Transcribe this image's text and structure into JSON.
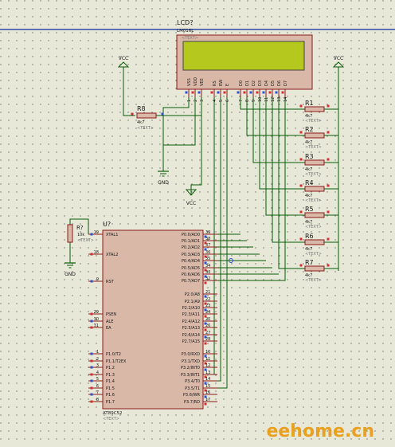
{
  "lcd": {
    "ref": "LCD?",
    "part": "LM016L",
    "text_tag": "<TEXT>",
    "pins": [
      "VSS",
      "VDD",
      "VEE",
      "RS",
      "RW",
      "E",
      "D0",
      "D1",
      "D2",
      "D3",
      "D4",
      "D5",
      "D6",
      "D7"
    ],
    "pin_numbers": [
      "1",
      "2",
      "3",
      "4",
      "5",
      "6",
      "7",
      "8",
      "9",
      "10",
      "11",
      "12",
      "13",
      "14"
    ],
    "screen_color": "#b5c81e"
  },
  "power": {
    "vcc_label_left": "VCC",
    "vcc_label_right": "VCC",
    "vcc_label_mid": "VCC",
    "gnd_label_lcd": "GND",
    "gnd_label_mcu": "GND"
  },
  "r8": {
    "ref": "R8",
    "value": "4k7",
    "text_tag": "<TEXT>"
  },
  "r_reset": {
    "ref": "R?",
    "value": "10k",
    "text_tag": "<TEXT>"
  },
  "resistor_pack": [
    {
      "ref": "R1",
      "value": "4k7",
      "text_tag": "<TEXT>"
    },
    {
      "ref": "R2",
      "value": "4k7",
      "text_tag": "<TEXT>"
    },
    {
      "ref": "R3",
      "value": "4k7",
      "text_tag": "<TEXT>"
    },
    {
      "ref": "R4",
      "value": "4k7",
      "text_tag": "<TEXT>"
    },
    {
      "ref": "R5",
      "value": "4k7",
      "text_tag": "<TEXT>"
    },
    {
      "ref": "R6",
      "value": "4k7",
      "text_tag": "<TEXT>"
    },
    {
      "ref": "R7",
      "value": "4k7",
      "text_tag": "<TEXT>"
    }
  ],
  "mcu": {
    "ref": "U?",
    "part": "AT89C52",
    "text_tag": "<TEXT>",
    "left_pins": [
      {
        "name": "XTAL1",
        "num": "19"
      },
      {
        "name": "XTAL2",
        "num": "18"
      },
      {
        "name": "RST",
        "num": "9"
      },
      {
        "name": "PSEN",
        "num": "29"
      },
      {
        "name": "ALE",
        "num": "30"
      },
      {
        "name": "EA",
        "num": "31"
      },
      {
        "name": "P1.0/T2",
        "num": "1"
      },
      {
        "name": "P1.1/T2EX",
        "num": "2"
      },
      {
        "name": "P1.2",
        "num": "3"
      },
      {
        "name": "P1.3",
        "num": "4"
      },
      {
        "name": "P1.4",
        "num": "5"
      },
      {
        "name": "P1.5",
        "num": "6"
      },
      {
        "name": "P1.6",
        "num": "7"
      },
      {
        "name": "P1.7",
        "num": "8"
      }
    ],
    "right_pins": [
      {
        "name": "P0.0/AD0",
        "num": "39"
      },
      {
        "name": "P0.1/AD1",
        "num": "38"
      },
      {
        "name": "P0.2/AD2",
        "num": "37"
      },
      {
        "name": "P0.3/AD3",
        "num": "36"
      },
      {
        "name": "P0.4/AD4",
        "num": "35"
      },
      {
        "name": "P0.5/AD5",
        "num": "34"
      },
      {
        "name": "P0.6/AD6",
        "num": "33"
      },
      {
        "name": "P0.7/AD7",
        "num": "32"
      },
      {
        "name": "P2.0/A8",
        "num": "21"
      },
      {
        "name": "P2.1/A9",
        "num": "22"
      },
      {
        "name": "P2.2/A10",
        "num": "23"
      },
      {
        "name": "P2.3/A11",
        "num": "24"
      },
      {
        "name": "P2.4/A12",
        "num": "25"
      },
      {
        "name": "P2.5/A13",
        "num": "26"
      },
      {
        "name": "P2.6/A14",
        "num": "27"
      },
      {
        "name": "P2.7/A15",
        "num": "28"
      },
      {
        "name": "P3.0/RXD",
        "num": "10"
      },
      {
        "name": "P3.1/TXD",
        "num": "11"
      },
      {
        "name": "P3.2/INT0",
        "num": "12"
      },
      {
        "name": "P3.3/INT1",
        "num": "13"
      },
      {
        "name": "P3.4/T0",
        "num": "14"
      },
      {
        "name": "P3.5/T1",
        "num": "15"
      },
      {
        "name": "P3.6/WR",
        "num": "16"
      },
      {
        "name": "P3.7/RD",
        "num": "17"
      }
    ]
  },
  "watermark": {
    "text": "eehome.cn",
    "color": "#e8a020"
  },
  "colors": {
    "background": "#e8e8d8",
    "grid_dot": "#6a6a6a",
    "component_body": "#d9b8a8",
    "component_outline": "#8b1a1a",
    "wire": "#0a5c0a",
    "label": "#1a1a1a",
    "pin_marker_red": "#d03030",
    "pin_marker_blue": "#3050d0"
  }
}
